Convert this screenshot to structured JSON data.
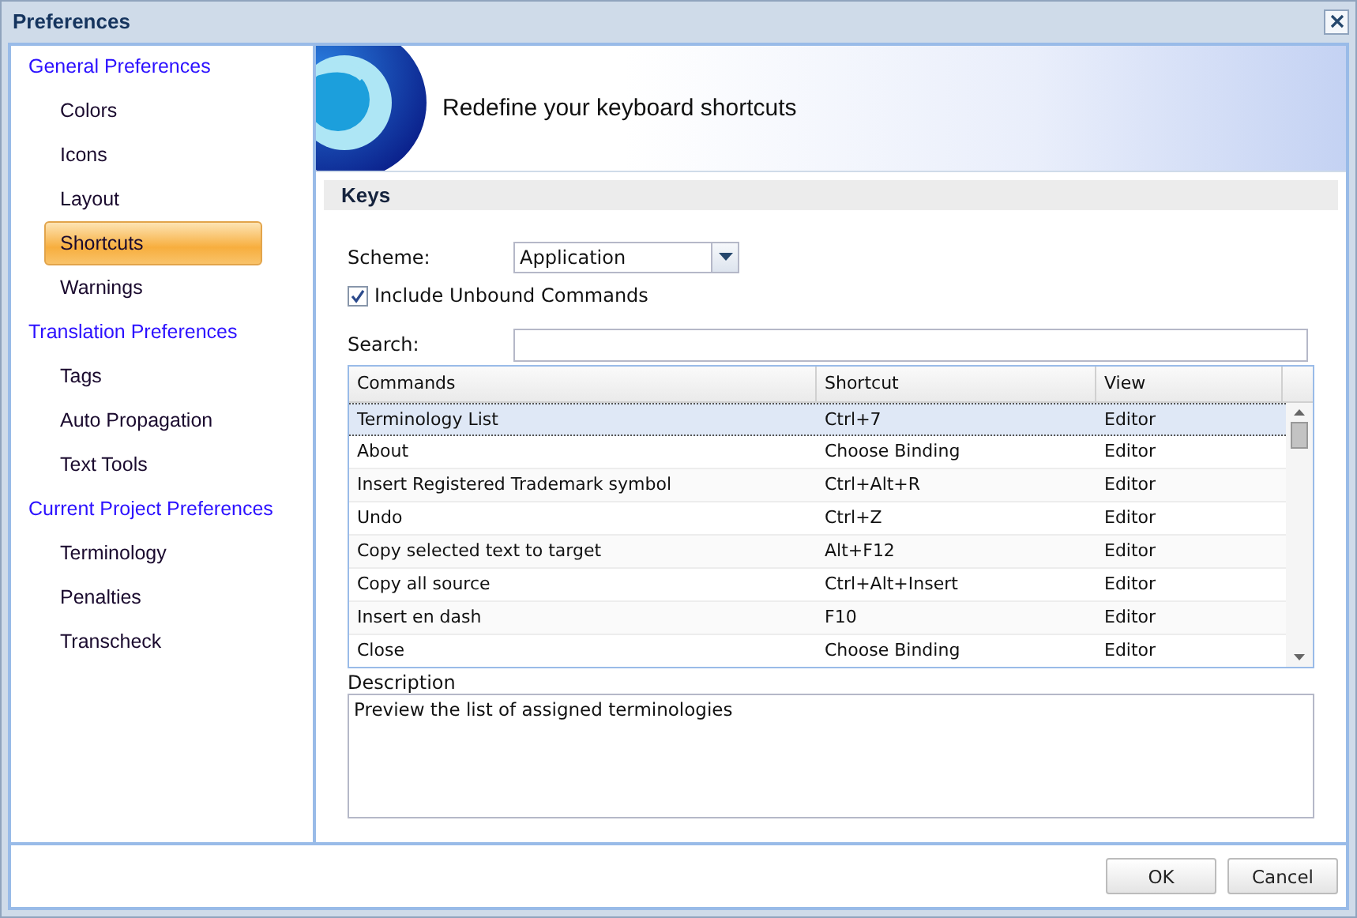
{
  "window": {
    "title": "Preferences"
  },
  "sidebar": {
    "groups": [
      {
        "label": "General Preferences",
        "children": [
          {
            "label": "Colors",
            "selected": false
          },
          {
            "label": "Icons",
            "selected": false
          },
          {
            "label": "Layout",
            "selected": false
          },
          {
            "label": "Shortcuts",
            "selected": true
          },
          {
            "label": "Warnings",
            "selected": false
          }
        ]
      },
      {
        "label": "Translation Preferences",
        "children": [
          {
            "label": "Tags",
            "selected": false
          },
          {
            "label": "Auto Propagation",
            "selected": false
          },
          {
            "label": "Text Tools",
            "selected": false
          }
        ]
      },
      {
        "label": "Current Project Preferences",
        "children": [
          {
            "label": "Terminology",
            "selected": false
          },
          {
            "label": "Penalties",
            "selected": false
          },
          {
            "label": "Transcheck",
            "selected": false
          }
        ]
      }
    ]
  },
  "banner": {
    "title": "Redefine your keyboard shortcuts"
  },
  "section": {
    "title": "Keys"
  },
  "scheme": {
    "label": "Scheme:",
    "value": "Application"
  },
  "include_unbound": {
    "label": "Include Unbound Commands",
    "checked": true
  },
  "search": {
    "label": "Search:"
  },
  "table": {
    "columns": [
      "Commands",
      "Shortcut",
      "View"
    ],
    "rows": [
      {
        "cells": [
          "Terminology List",
          "Ctrl+7",
          "Editor"
        ],
        "selected": true
      },
      {
        "cells": [
          "About",
          "Choose Binding",
          "Editor"
        ],
        "selected": false
      },
      {
        "cells": [
          "Insert Registered Trademark symbol",
          "Ctrl+Alt+R",
          "Editor"
        ],
        "selected": false
      },
      {
        "cells": [
          "Undo",
          "Ctrl+Z",
          "Editor"
        ],
        "selected": false
      },
      {
        "cells": [
          "Copy selected text to target",
          "Alt+F12",
          "Editor"
        ],
        "selected": false
      },
      {
        "cells": [
          "Copy all source",
          "Ctrl+Alt+Insert",
          "Editor"
        ],
        "selected": false
      },
      {
        "cells": [
          "Insert en dash",
          "F10",
          "Editor"
        ],
        "selected": false
      },
      {
        "cells": [
          "Close",
          "Choose Binding",
          "Editor"
        ],
        "selected": false
      }
    ]
  },
  "description": {
    "label": "Description",
    "value": "Preview the list of assigned terminologies"
  },
  "buttons": [
    "OK",
    "Cancel"
  ]
}
